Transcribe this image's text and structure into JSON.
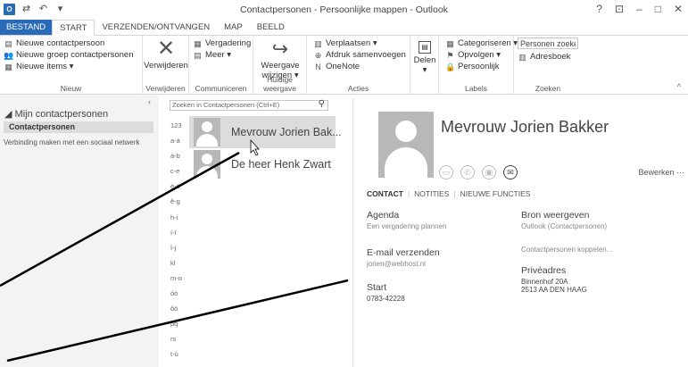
{
  "titlebar": {
    "title": "Contactpersonen - Persoonlijke mappen - Outlook",
    "app_icon": "outlook-icon",
    "help": "?",
    "ribbon_display": "⊡",
    "minimize": "–",
    "maximize": "□",
    "close": "✕"
  },
  "tabs": [
    "BESTAND",
    "START",
    "VERZENDEN/ONTVANGEN",
    "MAP",
    "BEELD"
  ],
  "ribbon": {
    "nieuw": {
      "label": "Nieuw",
      "items": [
        "Nieuwe contactpersoon",
        "Nieuwe groep contactpersonen",
        "Nieuwe items ▾"
      ]
    },
    "verwijderen": {
      "label": "Verwijderen",
      "button": "Verwijderen"
    },
    "communiceren": {
      "label": "Communiceren",
      "items": [
        "Vergadering",
        "Meer ▾"
      ]
    },
    "weergave": {
      "label": "Huidige weergave",
      "button_line1": "Weergave",
      "button_line2": "wijzigen ▾"
    },
    "acties": {
      "label": "Acties",
      "items": [
        "Verplaatsen ▾",
        "Afdruk samenvoegen",
        "OneNote"
      ]
    },
    "delen": {
      "button": "Delen",
      "arrow": "▾"
    },
    "labels": {
      "label": "Labels",
      "items": [
        "Categoriseren ▾",
        "Opvolgen ▾",
        "Persoonlijk"
      ]
    },
    "zoeken": {
      "label": "Zoeken",
      "search_people": "Personen zoeken",
      "address_book": "Adresboek"
    }
  },
  "folderpane": {
    "header": "◢ Mijn contactpersonen",
    "selected": "Contactpersonen",
    "social": "Verbinding maken met een sociaal netwerk"
  },
  "listpane": {
    "search_placeholder": "Zoeken in Contactpersonen (Ctrl+E)",
    "index": [
      "123",
      "a-á",
      "à-b",
      "c-e",
      "é-ë",
      "ê-g",
      "h-i",
      "í-ï",
      "î-j",
      "kl",
      "m-o",
      "óò",
      "ôö",
      "pq",
      "rs",
      "t-ú",
      "ùü"
    ],
    "contacts": [
      {
        "name": "Mevrouw Jorien Bak..."
      },
      {
        "name": "De heer Henk Zwart"
      }
    ]
  },
  "reading": {
    "full_name": "Mevrouw Jorien Bakker",
    "edit": "Bewerken  ···",
    "subtabs": [
      "CONTACT",
      "NOTITIES",
      "NIEUWE FUNCTIES"
    ],
    "agenda_label": "Agenda",
    "agenda_value": "Een vergadering plannen",
    "email_label": "E-mail verzenden",
    "email_value": "jorien@webhost.nl",
    "start_label": "Start",
    "start_value": "0783-42228",
    "source_label": "Bron weergeven",
    "source_value": "Outlook (Contactpersonen)",
    "link_value": "Contactpersonen koppelen...",
    "address_label": "Privéadres",
    "address_line1": "Binnenhof 20A",
    "address_line2": "2513 AA DEN HAAG"
  },
  "colors": {
    "brand": "#2a6bb7",
    "selected_bg": "#dcdcdc",
    "folder_bg": "#f3f3f3"
  }
}
